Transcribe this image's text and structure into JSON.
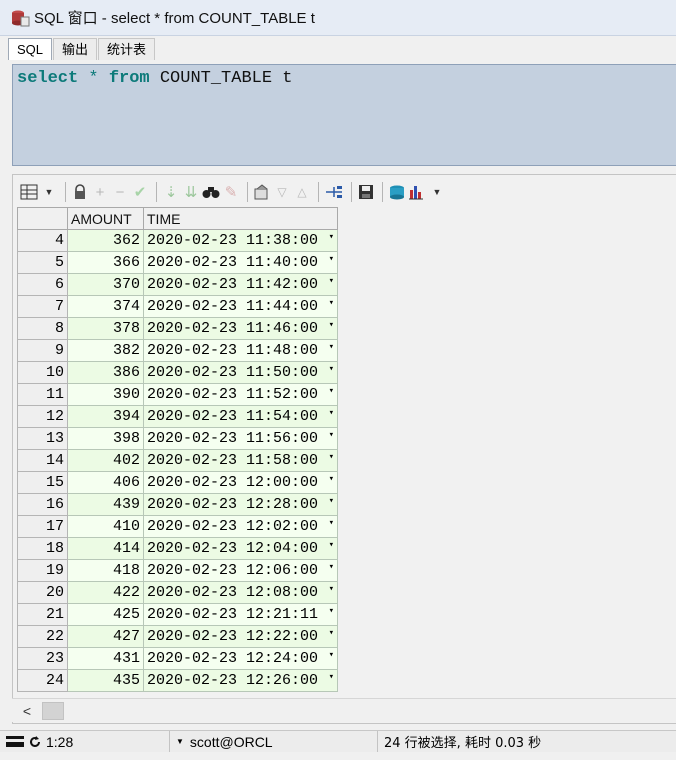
{
  "window": {
    "title": "SQL 窗口 - select * from COUNT_TABLE t",
    "app_icon": "database-icon"
  },
  "tabs": [
    {
      "label": "SQL",
      "active": true
    },
    {
      "label": "输出",
      "active": false
    },
    {
      "label": "统计表",
      "active": false
    }
  ],
  "editor": {
    "sql": {
      "kw1": "select",
      "star": "*",
      "kw2": "from",
      "table": "COUNT_TABLE",
      "alias": "t"
    }
  },
  "toolbar": {
    "icons": [
      "grid-icon",
      "dropdown-arrow-icon",
      "lock-icon",
      "plus-icon",
      "minus-icon",
      "checkmark-icon",
      "down-arrow-icon",
      "double-down-arrow-icon",
      "binoculars-icon",
      "eraser-icon",
      "export-icon",
      "triangle-down-icon",
      "triangle-up-icon",
      "tree-icon",
      "save-icon",
      "database-icon",
      "chart-icon"
    ]
  },
  "grid": {
    "columns": [
      "",
      "AMOUNT",
      "TIME"
    ],
    "rows": [
      {
        "n": "4",
        "amount": "362",
        "time": "2020-02-23 11:38:00"
      },
      {
        "n": "5",
        "amount": "366",
        "time": "2020-02-23 11:40:00"
      },
      {
        "n": "6",
        "amount": "370",
        "time": "2020-02-23 11:42:00"
      },
      {
        "n": "7",
        "amount": "374",
        "time": "2020-02-23 11:44:00"
      },
      {
        "n": "8",
        "amount": "378",
        "time": "2020-02-23 11:46:00"
      },
      {
        "n": "9",
        "amount": "382",
        "time": "2020-02-23 11:48:00"
      },
      {
        "n": "10",
        "amount": "386",
        "time": "2020-02-23 11:50:00"
      },
      {
        "n": "11",
        "amount": "390",
        "time": "2020-02-23 11:52:00"
      },
      {
        "n": "12",
        "amount": "394",
        "time": "2020-02-23 11:54:00"
      },
      {
        "n": "13",
        "amount": "398",
        "time": "2020-02-23 11:56:00"
      },
      {
        "n": "14",
        "amount": "402",
        "time": "2020-02-23 11:58:00"
      },
      {
        "n": "15",
        "amount": "406",
        "time": "2020-02-23 12:00:00"
      },
      {
        "n": "16",
        "amount": "439",
        "time": "2020-02-23 12:28:00"
      },
      {
        "n": "17",
        "amount": "410",
        "time": "2020-02-23 12:02:00"
      },
      {
        "n": "18",
        "amount": "414",
        "time": "2020-02-23 12:04:00"
      },
      {
        "n": "19",
        "amount": "418",
        "time": "2020-02-23 12:06:00"
      },
      {
        "n": "20",
        "amount": "422",
        "time": "2020-02-23 12:08:00"
      },
      {
        "n": "21",
        "amount": "425",
        "time": "2020-02-23 12:21:11"
      },
      {
        "n": "22",
        "amount": "427",
        "time": "2020-02-23 12:22:00"
      },
      {
        "n": "23",
        "amount": "431",
        "time": "2020-02-23 12:24:00"
      },
      {
        "n": "24",
        "amount": "435",
        "time": "2020-02-23 12:26:00"
      }
    ]
  },
  "scrollbar": {
    "left_arrow": "<"
  },
  "status": {
    "cursor_position": "1:28",
    "connection": "scott@ORCL",
    "message": "24 行被选择, 耗时 0.03 秒"
  }
}
